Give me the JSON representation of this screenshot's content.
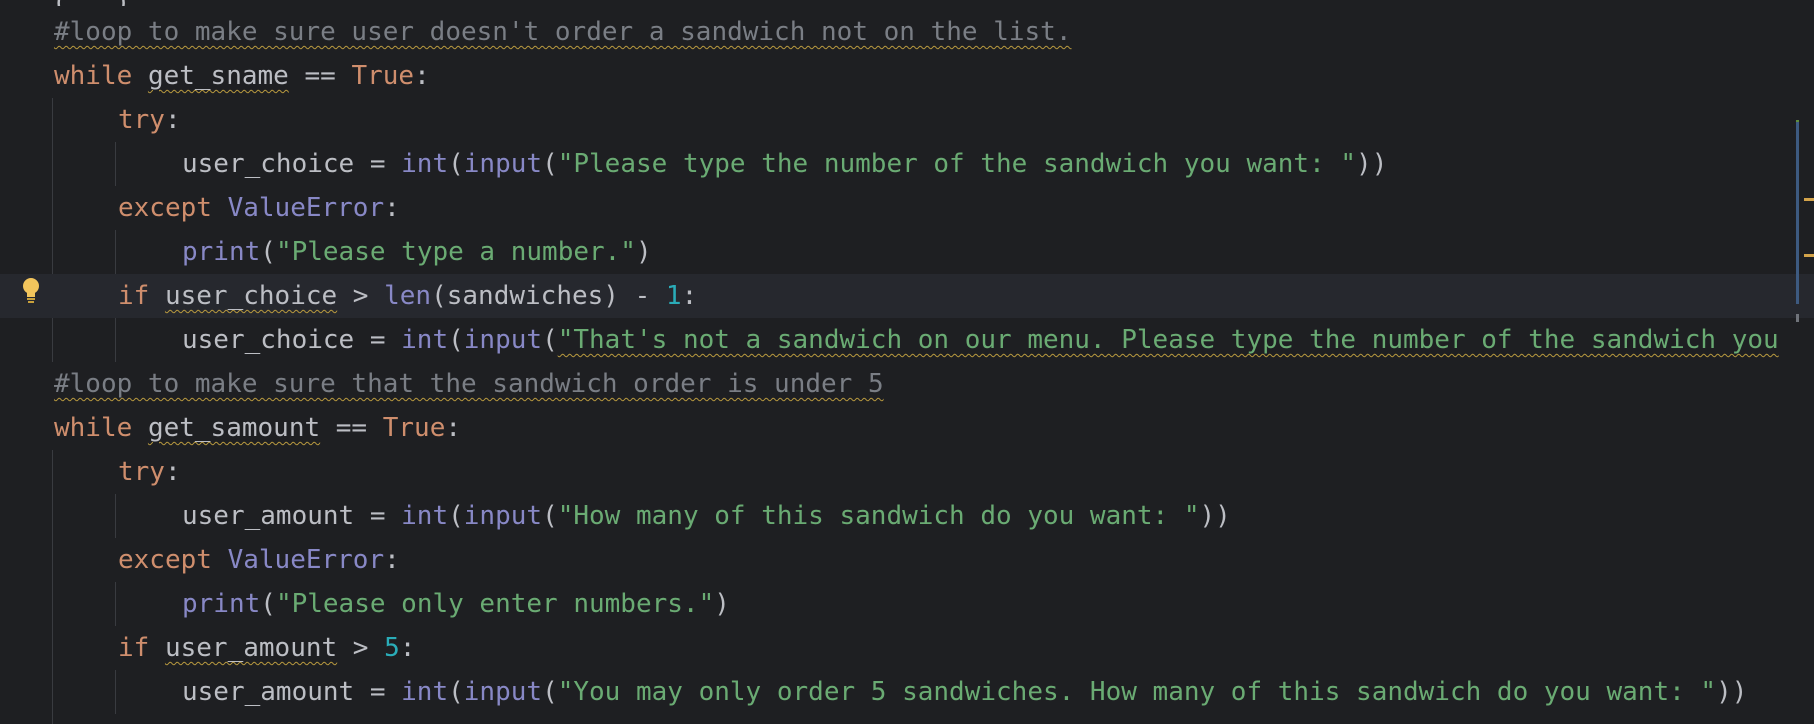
{
  "editor": {
    "language": "python",
    "colors": {
      "background": "#1e1f22",
      "current_line": "#26282e",
      "keyword": "#cf8e6d",
      "comment": "#7a7e85",
      "string": "#6aab73",
      "number": "#2aacb8",
      "builtin": "#8888c6",
      "text": "#bcbec4",
      "warning_underline": "#b99a3f"
    },
    "gutter": {
      "intention_icon": "lightbulb-icon"
    },
    "lines": [
      {
        "comment": "#loop to make sure user doesn't order a sandwich not on the list."
      },
      {
        "kw": "while",
        "var": "get_sname",
        "op": " == ",
        "val": "True",
        "end": ":"
      },
      {
        "kw": "try",
        "end": ":"
      },
      {
        "var": "user_choice",
        "op": " = ",
        "fn1": "int",
        "p1": "(",
        "fn2": "input",
        "p2": "(",
        "str": "\"Please type the number of the sandwich you want: \"",
        "close": "))"
      },
      {
        "kw": "except",
        "sp": " ",
        "exc": "ValueError",
        "end": ":"
      },
      {
        "fn": "print",
        "p": "(",
        "str": "\"Please type a number.\"",
        "close": ")"
      },
      {
        "kw": "if",
        "sp": " ",
        "var": "user_choice",
        "op": " > ",
        "fn": "len",
        "arg": "(sandwiches)",
        "op2": " - ",
        "num": "1",
        "end": ":"
      },
      {
        "var": "user_choice",
        "op": " = ",
        "fn1": "int",
        "p1": "(",
        "fn2": "input",
        "p2": "(",
        "str": "\"That's not a sandwich on our menu. Please type the number of the sandwich you"
      },
      {
        "comment": "#loop to make sure that the sandwich order is under 5"
      },
      {
        "kw": "while",
        "var": "get_samount",
        "op": " == ",
        "val": "True",
        "end": ":"
      },
      {
        "kw": "try",
        "end": ":"
      },
      {
        "var": "user_amount",
        "op": " = ",
        "fn1": "int",
        "p1": "(",
        "fn2": "input",
        "p2": "(",
        "str": "\"How many of this sandwich do you want: \"",
        "close": "))"
      },
      {
        "kw": "except",
        "sp": " ",
        "exc": "ValueError",
        "end": ":"
      },
      {
        "fn": "print",
        "p": "(",
        "str": "\"Please only enter numbers.\"",
        "close": ")"
      },
      {
        "kw": "if",
        "sp": " ",
        "var": "user_amount",
        "op": " > ",
        "num": "5",
        "end": ":"
      },
      {
        "var": "user_amount",
        "op": " = ",
        "fn1": "int",
        "p1": "(",
        "fn2": "input",
        "p2": "(",
        "str": "\"You may only order 5 sandwiches. How many of this sandwich do you want: \"",
        "close": "))"
      }
    ]
  }
}
